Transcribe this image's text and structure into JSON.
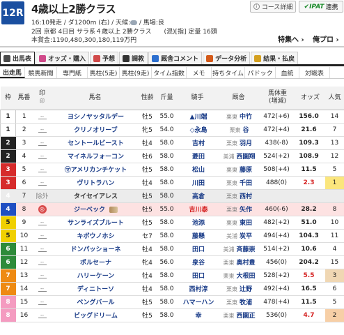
{
  "race": {
    "number": "12R",
    "name": "4歳以上2勝クラス",
    "meta1": "16:10発走 / ダ1200m (右) / 天候:",
    "weather_icon": "cloudy-icon",
    "meta1_tail": " / 馬場:良",
    "meta2": "2回 京都 4日目 サラ系４歳以上 2勝クラス　　(混)[指] 定量 16頭",
    "meta3": "本賞金:1190,480,300,180,119万円"
  },
  "buttons": {
    "course": "コース詳細",
    "ipat_brand": "IPAT",
    "ipat": "連携",
    "tokusyu": "特集へ ›",
    "haifuku": "俺プロ ›"
  },
  "tabs_main": [
    {
      "label": "出馬表",
      "icon": "table-icon",
      "color": "#4a4a4a",
      "active": true
    },
    {
      "label": "オッズ・購入",
      "icon": "ticket-icon",
      "color": "#d04a8a",
      "active": false
    },
    {
      "label": "予想",
      "icon": "target-icon",
      "color": "#d14a4a",
      "active": false
    },
    {
      "label": "調教",
      "icon": "clock-icon",
      "color": "#333333",
      "active": false
    },
    {
      "label": "厩舎コメント",
      "icon": "comment-icon",
      "color": "#2c6fcf",
      "active": false
    },
    {
      "label": "データ分析",
      "icon": "chart-icon",
      "color": "#d45a1a",
      "active": false
    },
    {
      "label": "結果・払戻",
      "icon": "money-icon",
      "color": "#d4a020",
      "active": false
    }
  ],
  "tabs_sub": [
    "出走馬",
    "競馬新聞",
    "専門紙",
    "馬柱(5走)",
    "馬柱(9走)",
    "タイム指数",
    "メモ",
    "持ちタイム",
    "パドック",
    "血統",
    "対戦表"
  ],
  "table": {
    "headers": {
      "waku": "枠",
      "umaban": "馬番",
      "mark": "印",
      "mark_sub": "印",
      "name": "馬名",
      "sex_age": "性齢",
      "kinryo": "斤量",
      "jockey": "騎手",
      "trainer": "厩舎",
      "weight": "馬体重",
      "weight_sub": "(増減)",
      "odds": "オッズ",
      "pop": "人気"
    },
    "rows": [
      {
        "waku": "1",
        "umaban": "1",
        "mark": "--",
        "name": "ヨシノヤッタルデー",
        "sex": "牡5",
        "kinryo": "55.0",
        "jockey": "▲川端",
        "region": "栗東",
        "trainer": "中竹",
        "weight": "472(+6)",
        "odds": "156.0",
        "pop": "14"
      },
      {
        "waku": "1",
        "umaban": "2",
        "mark": "--",
        "name": "クリノオリーブ",
        "sex": "牝5",
        "kinryo": "54.0",
        "jockey": "◇永島",
        "region": "栗東",
        "trainer": "谷",
        "weight": "472(+4)",
        "odds": "21.6",
        "pop": "7"
      },
      {
        "waku": "2",
        "umaban": "3",
        "mark": "--",
        "name": "セントールビースト",
        "sex": "牡4",
        "kinryo": "58.0",
        "jockey": "吉村",
        "region": "栗東",
        "trainer": "羽月",
        "weight": "438(-8)",
        "odds": "109.3",
        "pop": "13"
      },
      {
        "waku": "2",
        "umaban": "4",
        "mark": "--",
        "name": "マイネルフォーコン",
        "sex": "牡6",
        "kinryo": "58.0",
        "jockey": "菱田",
        "region": "美浦",
        "trainer": "西園翔",
        "weight": "524(+2)",
        "odds": "108.9",
        "pop": "12"
      },
      {
        "waku": "3",
        "umaban": "5",
        "mark": "--",
        "name": "㋮アメリカンチケット",
        "sex": "牡5",
        "kinryo": "58.0",
        "jockey": "松山",
        "region": "栗東",
        "trainer": "藤原",
        "weight": "508(+4)",
        "odds": "11.5",
        "pop": "5"
      },
      {
        "waku": "3",
        "umaban": "6",
        "mark": "--",
        "name": "ヴリトラハン",
        "sex": "牡4",
        "kinryo": "58.0",
        "jockey": "川田",
        "region": "栗東",
        "trainer": "千田",
        "weight": "488(0)",
        "odds": "2.3",
        "pop": "1"
      },
      {
        "waku": "4",
        "umaban": "7",
        "mark": "除外",
        "name": "タイセイアレス",
        "sex": "牡5",
        "kinryo": "58.0",
        "jockey": "高倉",
        "region": "栗東",
        "trainer": "西村",
        "weight": "",
        "odds": "",
        "pop": "",
        "scratched": true
      },
      {
        "waku": "4",
        "umaban": "8",
        "mark": "stable-icon",
        "name": "ジーベック",
        "sex": "牡5",
        "kinryo": "55.0",
        "jockey": "吉川泰",
        "region": "栗東",
        "trainer": "矢作",
        "weight": "460(-6)",
        "odds": "28.2",
        "pop": "8",
        "highlight": true
      },
      {
        "waku": "5",
        "umaban": "9",
        "mark": "--",
        "name": "サンライズブルート",
        "sex": "牡5",
        "kinryo": "58.0",
        "jockey": "池添",
        "region": "栗東",
        "trainer": "東田",
        "weight": "482(+2)",
        "odds": "51.0",
        "pop": "10"
      },
      {
        "waku": "5",
        "umaban": "10",
        "mark": "--",
        "name": "キボウノホシ",
        "sex": "セ7",
        "kinryo": "58.0",
        "jockey": "藤懸",
        "region": "美浦",
        "trainer": "炭平",
        "weight": "494(+4)",
        "odds": "104.3",
        "pop": "11"
      },
      {
        "waku": "6",
        "umaban": "11",
        "mark": "--",
        "name": "ドンパッショーネ",
        "sex": "牡4",
        "kinryo": "58.0",
        "jockey": "田口",
        "region": "美浦",
        "trainer": "斉藤崇",
        "weight": "514(+2)",
        "odds": "10.6",
        "pop": "4"
      },
      {
        "waku": "6",
        "umaban": "12",
        "mark": "--",
        "name": "ポルセーナ",
        "sex": "牝4",
        "kinryo": "56.0",
        "jockey": "泉谷",
        "region": "栗東",
        "trainer": "奥村豊",
        "weight": "456(0)",
        "odds": "204.2",
        "pop": "15"
      },
      {
        "waku": "7",
        "umaban": "13",
        "mark": "--",
        "name": "ハリーケーン",
        "sex": "牡4",
        "kinryo": "58.0",
        "jockey": "田口",
        "region": "栗東",
        "trainer": "大根田",
        "weight": "528(+2)",
        "odds": "5.5",
        "pop": "3"
      },
      {
        "waku": "7",
        "umaban": "14",
        "mark": "--",
        "name": "ディニトーソ",
        "sex": "牡4",
        "kinryo": "58.0",
        "jockey": "西村淳",
        "region": "栗東",
        "trainer": "辻野",
        "weight": "492(+4)",
        "odds": "16.5",
        "pop": "6"
      },
      {
        "waku": "8",
        "umaban": "15",
        "mark": "--",
        "name": "ベングバール",
        "sex": "牡5",
        "kinryo": "58.0",
        "jockey": "ハマーハン",
        "region": "栗東",
        "trainer": "牧浦",
        "weight": "478(+4)",
        "odds": "11.5",
        "pop": "5"
      },
      {
        "waku": "8",
        "umaban": "16",
        "mark": "--",
        "name": "ビッグドリーム",
        "sex": "牡5",
        "kinryo": "58.0",
        "jockey": "幸",
        "region": "栗東",
        "trainer": "西園正",
        "weight": "536(0)",
        "odds": "4.7",
        "pop": "2"
      }
    ]
  },
  "colors": {
    "race_badge": "#1a4fa0",
    "link_blue": "#1a3c88",
    "odds_red": "#d41f1f",
    "pop1": "#fbe67d",
    "pop2": "#f7cfa6",
    "pop3": "#f0d7b3"
  }
}
